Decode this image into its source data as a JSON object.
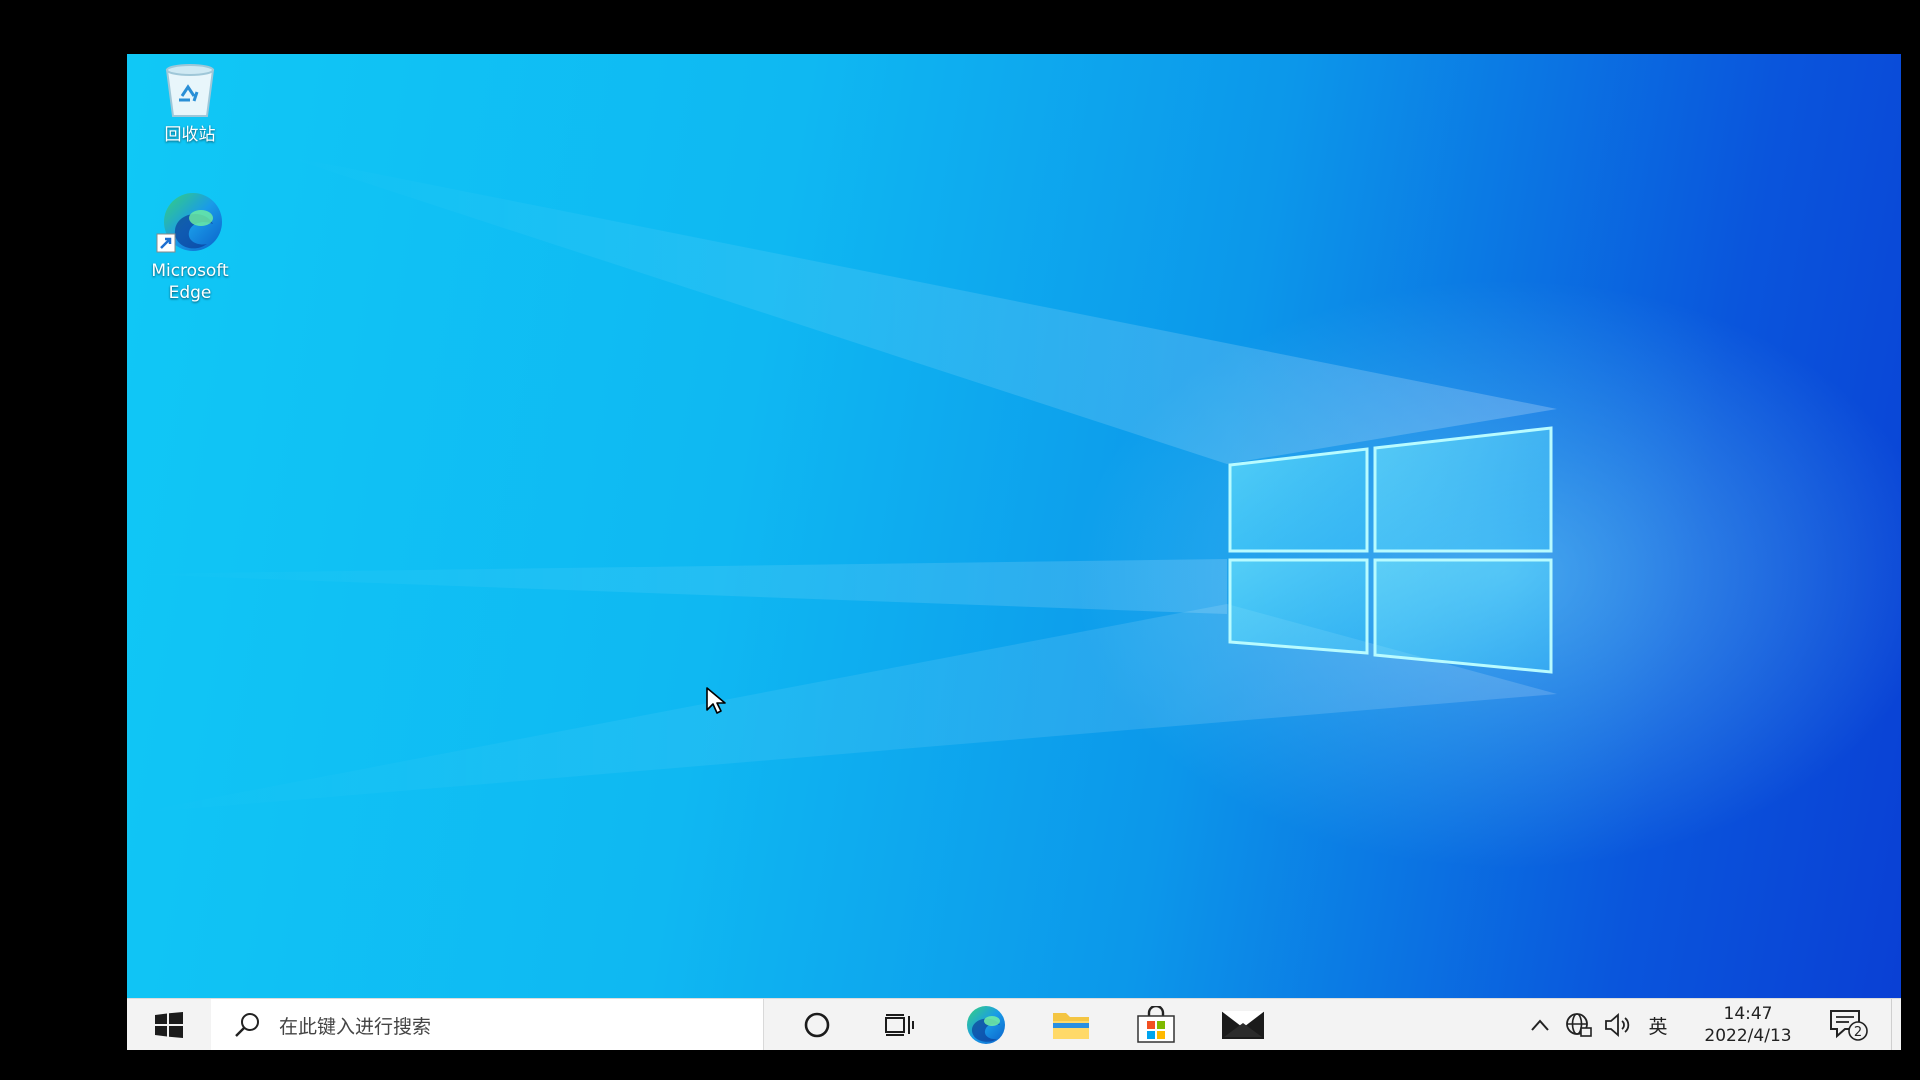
{
  "desktop": {
    "icons": [
      {
        "label": "回收站",
        "icon": "recycle-bin-icon"
      },
      {
        "label": "Microsoft\nEdge",
        "icon": "edge-icon"
      }
    ]
  },
  "taskbar": {
    "start_icon": "windows-logo-icon",
    "search": {
      "placeholder": "在此键入进行搜索",
      "icon": "search-icon"
    },
    "cortana_icon": "circle-icon",
    "taskview_icon": "task-view-icon",
    "apps": [
      {
        "name": "Microsoft Edge",
        "icon": "edge-icon"
      },
      {
        "name": "File Explorer",
        "icon": "folder-icon"
      },
      {
        "name": "Microsoft Store",
        "icon": "store-bag-icon"
      },
      {
        "name": "Mail",
        "icon": "mail-icon"
      }
    ],
    "tray": {
      "chevron_icon": "chevron-up-icon",
      "network_icon": "globe-icon",
      "volume_icon": "speaker-icon",
      "ime": "英",
      "time": "14:47",
      "date": "2022/4/13",
      "notification_count": "2"
    }
  },
  "colors": {
    "wallpaper_light": "#10c8f6",
    "wallpaper_dark": "#0a3fd4",
    "taskbar": "#f3f3f3"
  }
}
